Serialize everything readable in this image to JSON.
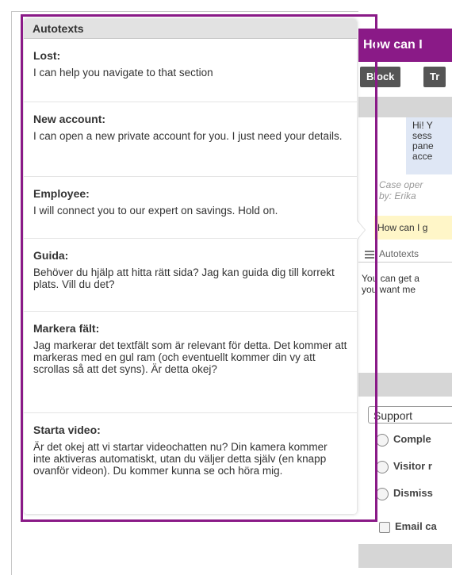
{
  "chat": {
    "header_text": "How can I",
    "toolbar": {
      "block_label": "Block",
      "tr_label": "Tr"
    },
    "bubble_lines": [
      "Hi! Y",
      "sess",
      "pane",
      "acce"
    ],
    "case_lines": [
      "Case oper",
      "by: Erika"
    ],
    "highlighted_message": "How can I g",
    "autotexts_tab_label": "Autotexts",
    "message_lines": [
      "You can get a",
      "you want me"
    ],
    "category_select_value": "Support",
    "radio_options": [
      "Comple",
      "Visitor r",
      "Dismiss"
    ],
    "email_checkbox_label": "Email ca"
  },
  "popup": {
    "title": "Autotexts",
    "items": [
      {
        "title": "Lost:",
        "text": "I can help you navigate to that section"
      },
      {
        "title": "New account:",
        "text": "I can open a new private account for you. I just need your details."
      },
      {
        "title": "Employee:",
        "text": "I will connect you to our expert on savings. Hold on."
      },
      {
        "title": "Guida:",
        "text": "Behöver du hjälp att hitta rätt sida? Jag kan guida dig till korrekt plats. Vill du det?"
      },
      {
        "title": "Markera fält:",
        "text": "Jag markerar det textfält som är relevant för detta. Det kommer att markeras med en gul ram (och eventuellt kommer din vy att scrollas så att det syns). Är detta okej?"
      },
      {
        "title": "Starta video:",
        "text": "Är det okej att vi startar videochatten nu? Din kamera kommer inte aktiveras automatiskt, utan du väljer detta själv (en knapp ovanför videon). Du kommer kunna se och höra mig."
      }
    ]
  },
  "colors": {
    "accent_purple": "#8a1a87",
    "highlight_yellow": "#fff6c8",
    "bubble_blue": "#dfe7f5"
  }
}
